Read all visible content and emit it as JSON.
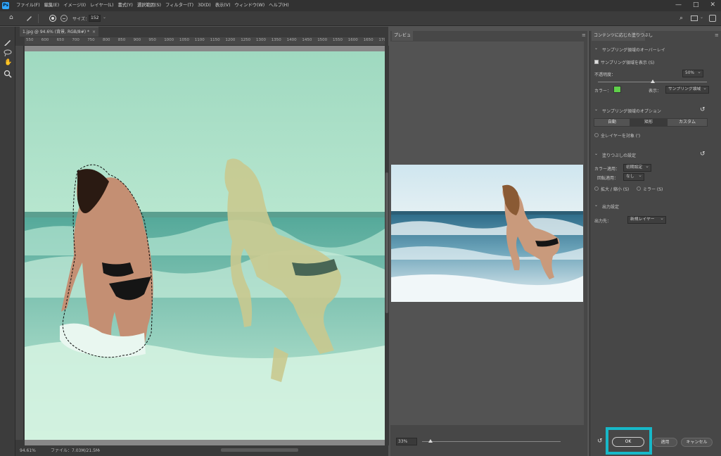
{
  "menu": {
    "items": [
      "ファイル(F)",
      "編集(E)",
      "イメージ(I)",
      "レイヤー(L)",
      "書式(Y)",
      "選択範囲(S)",
      "フィルター(T)",
      "3D(D)",
      "表示(V)",
      "ウィンドウ(W)",
      "ヘルプ(H)"
    ],
    "window_buttons": [
      "—",
      "□",
      "✕"
    ]
  },
  "options_bar": {
    "size_label": "サイズ：",
    "size_value": "152"
  },
  "document": {
    "tab_title": "1.jpg @ 94.6% (背景, RGB/8#) *",
    "ruler_ticks": [
      "550",
      "600",
      "650",
      "700",
      "750",
      "800",
      "850",
      "900",
      "950",
      "1000",
      "1050",
      "1100",
      "1150",
      "1200",
      "1250",
      "1300",
      "1350",
      "1400",
      "1450",
      "1500",
      "1550",
      "1600",
      "1650",
      "1700"
    ],
    "status_zoom": "94.61%",
    "status_file": "ファイル：7.03M/21.5M"
  },
  "preview": {
    "tab_label": "プレビュー",
    "zoom_value": "33%",
    "zoom_level": 0.05
  },
  "caf": {
    "tab_label": "コンテンツに応じた塗りつぶし",
    "overlay_section": "サンプリング領域のオーバーレイ",
    "show_sampling_label": "サンプリング領域を表示 (S)",
    "show_sampling_checked": true,
    "opacity_label": "不透明度：",
    "opacity_value": "50%",
    "opacity_level": 0.5,
    "color_label": "カラー：",
    "overlay_color": "#5fd04a",
    "display_label": "表示：",
    "display_value": "サンプリング領域",
    "options_section": "サンプリング領域のオプション",
    "seg_auto": "自動",
    "seg_rect": "矩形",
    "seg_custom": "カスタム",
    "all_layers_label": "全レイヤーを対象 (')",
    "fill_section": "塗りつぶしの設定",
    "color_adapt_label": "カラー適用：",
    "color_adapt_value": "初期設定",
    "rotation_label": "回転適用：",
    "rotation_value": "なし",
    "scale_label": "拡大 / 縮小 (S)",
    "mirror_label": "ミラー (S)",
    "output_section": "出力設定",
    "output_label": "出力先：",
    "output_value": "新規レイヤー",
    "ok_label": "OK",
    "apply_label": "適用",
    "cancel_label": "キャンセル"
  },
  "colors": {
    "accent_highlight": "#17b8c8",
    "app_bg": "#535353"
  }
}
